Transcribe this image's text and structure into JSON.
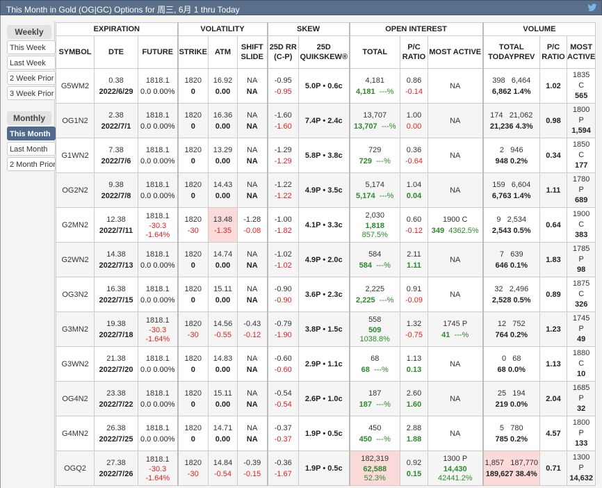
{
  "title": "This Month in Gold (OG|GC) Options for 周三, 6月 1 thru Today",
  "sidebar": {
    "weekly_label": "Weekly",
    "weekly_items": [
      "This Week",
      "Last Week",
      "2 Week Prior",
      "3 Week Prior"
    ],
    "monthly_label": "Monthly",
    "monthly_items": [
      "This Month",
      "Last Month",
      "2 Month Prior"
    ],
    "active": "This Month"
  },
  "header_groups": [
    "EXPIRATION",
    "VOLATILITY",
    "SKEW",
    "OPEN INTEREST",
    "VOLUME"
  ],
  "columns": [
    "SYMBOL",
    "DTE",
    "FUTURE",
    "STRIKE",
    "ATM",
    "SHIFT SLIDE",
    "25D RR (C-P)",
    "25D QUIKSKEW®",
    "TOTAL",
    "P/C RATIO",
    "MOST ACTIVE",
    "TOTAL TODAYPREV",
    "P/C RATIO",
    "MOST ACTIVE"
  ],
  "rows": [
    {
      "symbol": "G5WM2",
      "dte": "0.38",
      "date": "2022/6/29",
      "fut": "1818.1",
      "fut_chg": "0.0 0.00%",
      "fut_neg": false,
      "fut_chg1": "",
      "fut_chg2": "",
      "strike": "1820",
      "strike_chg": "0",
      "atm": "16.92",
      "atm_chg": "0.00",
      "shift": "NA",
      "slide": "NA",
      "rr": "-0.95",
      "rr_chg": "-0.95",
      "qs": "5.0P • 0.6c",
      "oi_total": "4,181",
      "oi_new": "4,181",
      "oi_pct": "---%",
      "oi_pct_split": false,
      "oi_pc": "0.86",
      "oi_pc_chg": "-0.14",
      "oi_pc_color": "r",
      "oi_ma": "NA",
      "oi_ma_a": "",
      "oi_ma_b": "",
      "vol_today": "398",
      "vol_prev": "6,464",
      "vol_total": "6,862",
      "vol_pct": "1.4%",
      "vol_pc": "1.02",
      "vol_ma_strike": "1835",
      "vol_ma_type": "C",
      "vol_ma_qty": "565"
    },
    {
      "symbol": "OG1N2",
      "dte": "2.38",
      "date": "2022/7/1",
      "fut": "1818.1",
      "fut_chg": "0.0 0.00%",
      "fut_neg": false,
      "fut_chg1": "",
      "fut_chg2": "",
      "strike": "1820",
      "strike_chg": "0",
      "atm": "16.36",
      "atm_chg": "0.00",
      "shift": "NA",
      "slide": "NA",
      "rr": "-1.60",
      "rr_chg": "-1.60",
      "qs": "7.4P • 2.4c",
      "oi_total": "13,707",
      "oi_new": "13,707",
      "oi_pct": "---%",
      "oi_pct_split": false,
      "oi_pc": "1.00",
      "oi_pc_chg": "0.00",
      "oi_pc_color": "r",
      "oi_ma": "NA",
      "oi_ma_a": "",
      "oi_ma_b": "",
      "vol_today": "174",
      "vol_prev": "21,062",
      "vol_total": "21,236",
      "vol_pct": "4.3%",
      "vol_pc": "0.98",
      "vol_ma_strike": "1800",
      "vol_ma_type": "P",
      "vol_ma_qty": "1,594"
    },
    {
      "symbol": "G1WN2",
      "dte": "7.38",
      "date": "2022/7/6",
      "fut": "1818.1",
      "fut_chg": "0.0 0.00%",
      "fut_neg": false,
      "fut_chg1": "",
      "fut_chg2": "",
      "strike": "1820",
      "strike_chg": "0",
      "atm": "13.29",
      "atm_chg": "0.00",
      "shift": "NA",
      "slide": "NA",
      "rr": "-1.29",
      "rr_chg": "-1.29",
      "qs": "5.8P • 3.8c",
      "oi_total": "729",
      "oi_new": "729",
      "oi_pct": "---%",
      "oi_pct_split": false,
      "oi_pc": "0.36",
      "oi_pc_chg": "-0.64",
      "oi_pc_color": "r",
      "oi_ma": "NA",
      "oi_ma_a": "",
      "oi_ma_b": "",
      "vol_today": "2",
      "vol_prev": "946",
      "vol_total": "948",
      "vol_pct": "0.2%",
      "vol_pc": "0.34",
      "vol_ma_strike": "1850",
      "vol_ma_type": "C",
      "vol_ma_qty": "177"
    },
    {
      "symbol": "OG2N2",
      "dte": "9.38",
      "date": "2022/7/8",
      "fut": "1818.1",
      "fut_chg": "0.0 0.00%",
      "fut_neg": false,
      "fut_chg1": "",
      "fut_chg2": "",
      "strike": "1820",
      "strike_chg": "0",
      "atm": "14.43",
      "atm_chg": "0.00",
      "shift": "NA",
      "slide": "NA",
      "rr": "-1.22",
      "rr_chg": "-1.22",
      "qs": "4.9P • 3.5c",
      "oi_total": "5,174",
      "oi_new": "5,174",
      "oi_pct": "---%",
      "oi_pct_split": false,
      "oi_pc": "1.04",
      "oi_pc_chg": "0.04",
      "oi_pc_color": "g",
      "oi_ma": "NA",
      "oi_ma_a": "",
      "oi_ma_b": "",
      "vol_today": "159",
      "vol_prev": "6,604",
      "vol_total": "6,763",
      "vol_pct": "1.4%",
      "vol_pc": "1.11",
      "vol_ma_strike": "1780",
      "vol_ma_type": "P",
      "vol_ma_qty": "689"
    },
    {
      "symbol": "G2MN2",
      "dte": "12.38",
      "date": "2022/7/11",
      "fut": "1818.1",
      "fut_chg": "",
      "fut_neg": true,
      "fut_chg1": "-30.3",
      "fut_chg2": "-1.64%",
      "strike": "1820",
      "strike_chg": "-30",
      "atm": "13.48",
      "atm_chg": "-1.35",
      "atm_highlight": true,
      "shift": "-1.28",
      "slide": "-0.08",
      "shift_neg": true,
      "rr": "-1.00",
      "rr_chg": "-1.82",
      "qs": "4.1P • 3.3c",
      "oi_total": "2,030",
      "oi_new": "1,818",
      "oi_pct": "857.5%",
      "oi_pct_split": true,
      "oi_pc": "0.60",
      "oi_pc_chg": "-0.12",
      "oi_pc_color": "r",
      "oi_ma": "1900 C",
      "oi_ma_a": "349",
      "oi_ma_b": "4362.5%",
      "vol_today": "9",
      "vol_prev": "2,534",
      "vol_total": "2,543",
      "vol_pct": "0.5%",
      "vol_pc": "0.64",
      "vol_ma_strike": "1900",
      "vol_ma_type": "C",
      "vol_ma_qty": "383"
    },
    {
      "symbol": "G2WN2",
      "dte": "14.38",
      "date": "2022/7/13",
      "fut": "1818.1",
      "fut_chg": "0.0 0.00%",
      "fut_neg": false,
      "fut_chg1": "",
      "fut_chg2": "",
      "strike": "1820",
      "strike_chg": "0",
      "atm": "14.74",
      "atm_chg": "0.00",
      "shift": "NA",
      "slide": "NA",
      "rr": "-1.02",
      "rr_chg": "-1.02",
      "qs": "4.9P • 2.0c",
      "oi_total": "584",
      "oi_new": "584",
      "oi_pct": "---%",
      "oi_pct_split": false,
      "oi_pc": "2.11",
      "oi_pc_chg": "1.11",
      "oi_pc_color": "g",
      "oi_ma": "NA",
      "oi_ma_a": "",
      "oi_ma_b": "",
      "vol_today": "7",
      "vol_prev": "639",
      "vol_total": "646",
      "vol_pct": "0.1%",
      "vol_pc": "1.83",
      "vol_ma_strike": "1785",
      "vol_ma_type": "P",
      "vol_ma_qty": "98"
    },
    {
      "symbol": "OG3N2",
      "dte": "16.38",
      "date": "2022/7/15",
      "fut": "1818.1",
      "fut_chg": "0.0 0.00%",
      "fut_neg": false,
      "fut_chg1": "",
      "fut_chg2": "",
      "strike": "1820",
      "strike_chg": "0",
      "atm": "15.11",
      "atm_chg": "0.00",
      "shift": "NA",
      "slide": "NA",
      "rr": "-0.90",
      "rr_chg": "-0.90",
      "qs": "3.6P • 2.3c",
      "oi_total": "2,225",
      "oi_new": "2,225",
      "oi_pct": "---%",
      "oi_pct_split": false,
      "oi_pc": "0.91",
      "oi_pc_chg": "-0.09",
      "oi_pc_color": "r",
      "oi_ma": "NA",
      "oi_ma_a": "",
      "oi_ma_b": "",
      "vol_today": "32",
      "vol_prev": "2,496",
      "vol_total": "2,528",
      "vol_pct": "0.5%",
      "vol_pc": "0.89",
      "vol_ma_strike": "1875",
      "vol_ma_type": "C",
      "vol_ma_qty": "326"
    },
    {
      "symbol": "G3MN2",
      "dte": "19.38",
      "date": "2022/7/18",
      "fut": "1818.1",
      "fut_chg": "",
      "fut_neg": true,
      "fut_chg1": "-30.3",
      "fut_chg2": "-1.64%",
      "strike": "1820",
      "strike_chg": "-30",
      "atm": "14.56",
      "atm_chg": "-0.55",
      "shift": "-0.43",
      "slide": "-0.12",
      "shift_neg": true,
      "rr": "-0.79",
      "rr_chg": "-1.90",
      "qs": "3.8P • 1.5c",
      "oi_total": "558",
      "oi_new": "509",
      "oi_pct": "1038.8%",
      "oi_pct_split": true,
      "oi_pc": "1.32",
      "oi_pc_chg": "-0.75",
      "oi_pc_color": "r",
      "oi_ma": "1745 P",
      "oi_ma_a": "41",
      "oi_ma_b": "---%",
      "vol_today": "12",
      "vol_prev": "752",
      "vol_total": "764",
      "vol_pct": "0.2%",
      "vol_pc": "1.23",
      "vol_ma_strike": "1745",
      "vol_ma_type": "P",
      "vol_ma_qty": "49"
    },
    {
      "symbol": "G3WN2",
      "dte": "21.38",
      "date": "2022/7/20",
      "fut": "1818.1",
      "fut_chg": "0.0 0.00%",
      "fut_neg": false,
      "fut_chg1": "",
      "fut_chg2": "",
      "strike": "1820",
      "strike_chg": "0",
      "atm": "14.83",
      "atm_chg": "0.00",
      "shift": "NA",
      "slide": "NA",
      "rr": "-0.60",
      "rr_chg": "-0.60",
      "qs": "2.9P • 1.1c",
      "oi_total": "68",
      "oi_new": "68",
      "oi_pct": "---%",
      "oi_pct_split": false,
      "oi_pc": "1.13",
      "oi_pc_chg": "0.13",
      "oi_pc_color": "g",
      "oi_ma": "NA",
      "oi_ma_a": "",
      "oi_ma_b": "",
      "vol_today": "0",
      "vol_prev": "68",
      "vol_total": "68",
      "vol_pct": "0.0%",
      "vol_pc": "1.13",
      "vol_ma_strike": "1880",
      "vol_ma_type": "C",
      "vol_ma_qty": "10"
    },
    {
      "symbol": "OG4N2",
      "dte": "23.38",
      "date": "2022/7/22",
      "fut": "1818.1",
      "fut_chg": "0.0 0.00%",
      "fut_neg": false,
      "fut_chg1": "",
      "fut_chg2": "",
      "strike": "1820",
      "strike_chg": "0",
      "atm": "15.11",
      "atm_chg": "0.00",
      "shift": "NA",
      "slide": "NA",
      "rr": "-0.54",
      "rr_chg": "-0.54",
      "qs": "2.6P • 1.0c",
      "oi_total": "187",
      "oi_new": "187",
      "oi_pct": "---%",
      "oi_pct_split": false,
      "oi_pc": "2.60",
      "oi_pc_chg": "1.60",
      "oi_pc_color": "g",
      "oi_ma": "NA",
      "oi_ma_a": "",
      "oi_ma_b": "",
      "vol_today": "25",
      "vol_prev": "194",
      "vol_total": "219",
      "vol_pct": "0.0%",
      "vol_pc": "2.04",
      "vol_ma_strike": "1685",
      "vol_ma_type": "P",
      "vol_ma_qty": "32"
    },
    {
      "symbol": "G4MN2",
      "dte": "26.38",
      "date": "2022/7/25",
      "fut": "1818.1",
      "fut_chg": "0.0 0.00%",
      "fut_neg": false,
      "fut_chg1": "",
      "fut_chg2": "",
      "strike": "1820",
      "strike_chg": "0",
      "atm": "14.71",
      "atm_chg": "0.00",
      "shift": "NA",
      "slide": "NA",
      "rr": "-0.37",
      "rr_chg": "-0.37",
      "qs": "1.9P • 0.5c",
      "oi_total": "450",
      "oi_new": "450",
      "oi_pct": "---%",
      "oi_pct_split": false,
      "oi_pc": "2.88",
      "oi_pc_chg": "1.88",
      "oi_pc_color": "g",
      "oi_ma": "NA",
      "oi_ma_a": "",
      "oi_ma_b": "",
      "vol_today": "5",
      "vol_prev": "780",
      "vol_total": "785",
      "vol_pct": "0.2%",
      "vol_pc": "4.57",
      "vol_ma_strike": "1800",
      "vol_ma_type": "P",
      "vol_ma_qty": "133"
    },
    {
      "symbol": "OGQ2",
      "dte": "27.38",
      "date": "2022/7/26",
      "fut": "1818.1",
      "fut_chg": "",
      "fut_neg": true,
      "fut_chg1": "-30.3",
      "fut_chg2": "-1.64%",
      "strike": "1820",
      "strike_chg": "-30",
      "atm": "14.84",
      "atm_chg": "-0.54",
      "shift": "-0.39",
      "slide": "-0.15",
      "shift_neg": true,
      "rr": "-0.36",
      "rr_chg": "-1.67",
      "qs": "1.9P • 0.5c",
      "oi_total": "182,319",
      "oi_new": "62,588",
      "oi_pct": "52.3%",
      "oi_pct_split": true,
      "oi_highlight": true,
      "oi_pc": "0.92",
      "oi_pc_chg": "0.15",
      "oi_pc_color": "g",
      "oi_ma": "1300 P",
      "oi_ma_a": "14,430",
      "oi_ma_b": "42441.2%",
      "oi_ma_split": true,
      "vol_today": "1,857",
      "vol_prev": "187,770",
      "vol_total": "189,627",
      "vol_pct": "38.4%",
      "vol_highlight": true,
      "vol_pc": "0.71",
      "vol_ma_strike": "1300",
      "vol_ma_type": "P",
      "vol_ma_qty": "14,632"
    }
  ],
  "colors": {
    "titlebar": "#5a6f8a",
    "active_tab": "#4f6a8c",
    "negative": "#dd2222",
    "positive": "#2a8a2a",
    "highlight": "#fbdada"
  }
}
